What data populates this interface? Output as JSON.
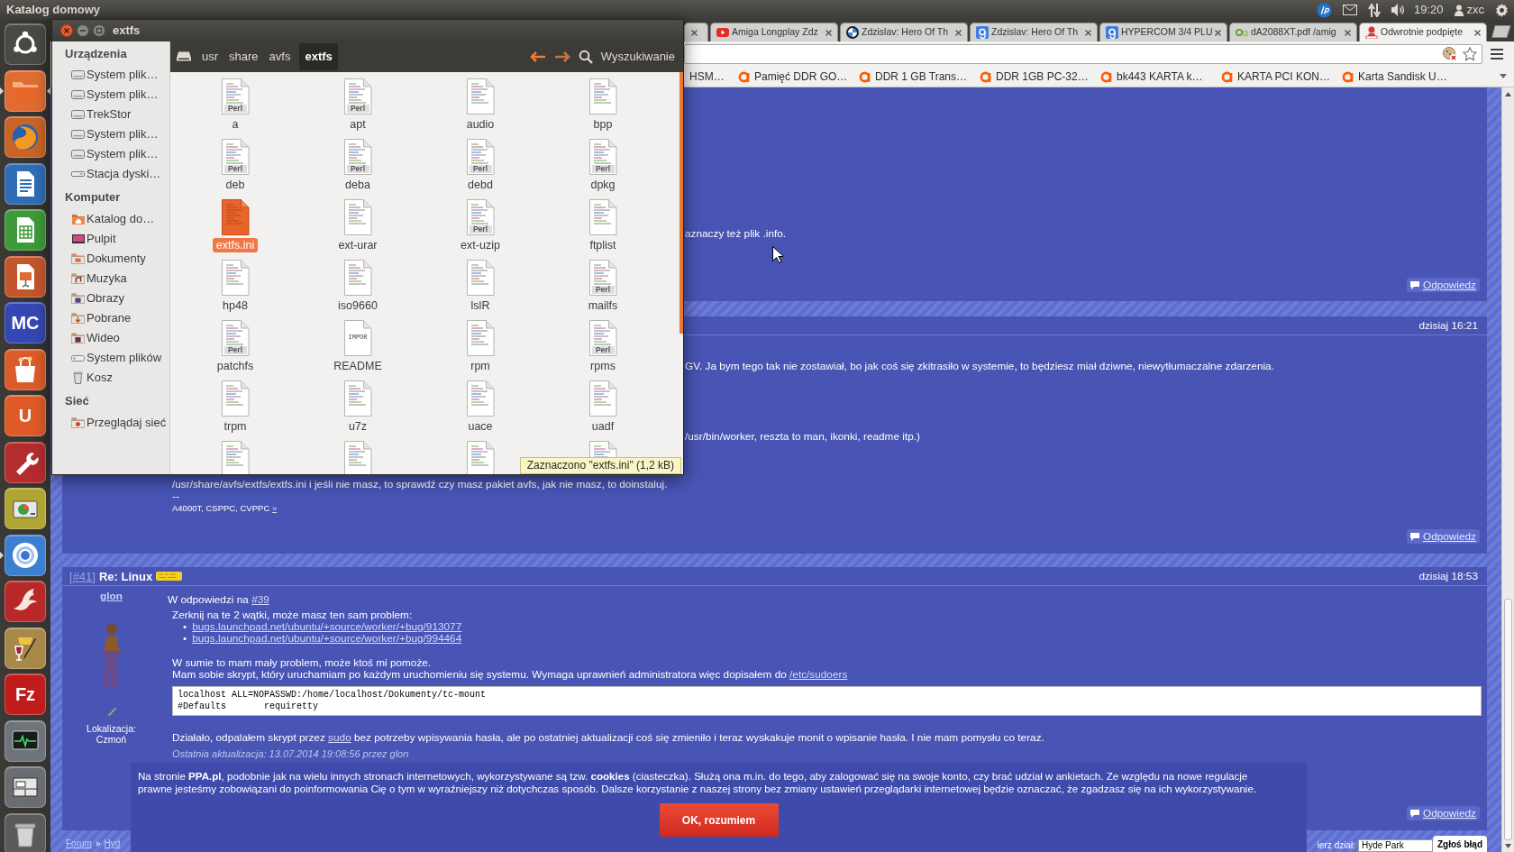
{
  "top_panel": {
    "title": "Katalog domowy",
    "clock": "19:20",
    "user": "zxc"
  },
  "launcher": [
    {
      "kind": "dash",
      "color": "#4a4946",
      "running": false,
      "focused": false
    },
    {
      "kind": "folder",
      "color": "#e06c34",
      "running": true,
      "focused": true
    },
    {
      "kind": "globe",
      "color": "#c86428",
      "running": false,
      "focused": false
    },
    {
      "kind": "document",
      "color": "#2f6db5",
      "running": false,
      "focused": false
    },
    {
      "kind": "spreadsheet",
      "color": "#3e9a3a",
      "running": false,
      "focused": false
    },
    {
      "kind": "slides",
      "color": "#c4562c",
      "running": false,
      "focused": false
    },
    {
      "kind": "letters",
      "text": "MC",
      "color": "#3547b3",
      "running": false,
      "focused": false
    },
    {
      "kind": "bag",
      "color": "#dc5b2a",
      "running": false,
      "focused": false
    },
    {
      "kind": "letters",
      "text": "U",
      "color": "#e05a28",
      "running": false,
      "focused": false
    },
    {
      "kind": "tools",
      "color": "#b32d2d",
      "running": false,
      "focused": false
    },
    {
      "kind": "disk",
      "color": "#b0a432",
      "running": false,
      "focused": false
    },
    {
      "kind": "ring",
      "color": "#3b7fd0",
      "running": true,
      "focused": false
    },
    {
      "kind": "bird",
      "color": "#b82828",
      "running": false,
      "focused": false
    },
    {
      "kind": "paint",
      "color": "#a8884a",
      "running": false,
      "focused": false
    },
    {
      "kind": "letters",
      "text": "Fz",
      "color": "#c01c1c",
      "running": false,
      "focused": false
    },
    {
      "kind": "monitor",
      "color": "#6e747a",
      "running": false,
      "focused": false
    },
    {
      "kind": "window",
      "color": "#6a6e72",
      "running": false,
      "focused": false
    },
    {
      "kind": "trash",
      "color": "#5a5a5a",
      "running": false,
      "focused": false
    }
  ],
  "file_manager": {
    "title": "extfs",
    "sidebar": [
      {
        "heading": "Urządzenia",
        "items": [
          {
            "kind": "drive",
            "label": "System plik…"
          },
          {
            "kind": "drive",
            "label": "System plik…"
          },
          {
            "kind": "drive",
            "label": "TrekStor"
          },
          {
            "kind": "drive",
            "label": "System plik…"
          },
          {
            "kind": "drive",
            "label": "System plik…"
          },
          {
            "kind": "removable",
            "label": "Stacja dyski…"
          }
        ]
      },
      {
        "heading": "Komputer",
        "items": [
          {
            "kind": "home",
            "label": "Katalog do…"
          },
          {
            "kind": "desktop",
            "label": "Pulpit"
          },
          {
            "kind": "documents",
            "label": "Dokumenty"
          },
          {
            "kind": "music",
            "label": "Muzyka"
          },
          {
            "kind": "pictures",
            "label": "Obrazy"
          },
          {
            "kind": "downloads",
            "label": "Pobrane"
          },
          {
            "kind": "videos",
            "label": "Wideo"
          },
          {
            "kind": "filesystem",
            "label": "System plików"
          },
          {
            "kind": "trash",
            "label": "Kosz"
          }
        ]
      },
      {
        "heading": "Sieć",
        "items": [
          {
            "kind": "network",
            "label": "Przeglądaj sieć"
          }
        ]
      }
    ],
    "path": [
      {
        "label": "usr",
        "selected": false
      },
      {
        "label": "share",
        "selected": false
      },
      {
        "label": "avfs",
        "selected": false
      },
      {
        "label": "extfs",
        "selected": true
      }
    ],
    "search": "Wyszukiwanie",
    "files": [
      {
        "name": "a",
        "kind": "perl",
        "badge": "Perl",
        "selected": false
      },
      {
        "name": "apt",
        "kind": "perl",
        "badge": "Perl",
        "selected": false
      },
      {
        "name": "audio",
        "kind": "text",
        "selected": false
      },
      {
        "name": "bpp",
        "kind": "text",
        "selected": false
      },
      {
        "name": "deb",
        "kind": "perl",
        "badge": "Perl",
        "selected": false
      },
      {
        "name": "deba",
        "kind": "perl",
        "badge": "Perl",
        "selected": false
      },
      {
        "name": "debd",
        "kind": "perl",
        "badge": "Perl",
        "selected": false
      },
      {
        "name": "dpkg",
        "kind": "perl",
        "badge": "Perl",
        "selected": false
      },
      {
        "name": "extfs.ini",
        "kind": "text",
        "selected": true
      },
      {
        "name": "ext-urar",
        "kind": "text",
        "selected": false
      },
      {
        "name": "ext-uzip",
        "kind": "perl",
        "badge": "Perl",
        "selected": false
      },
      {
        "name": "ftplist",
        "kind": "text",
        "selected": false
      },
      {
        "name": "hp48",
        "kind": "text",
        "selected": false
      },
      {
        "name": "iso9660",
        "kind": "text",
        "selected": false
      },
      {
        "name": "lslR",
        "kind": "text",
        "selected": false
      },
      {
        "name": "mailfs",
        "kind": "perl",
        "badge": "Perl",
        "selected": false
      },
      {
        "name": "patchfs",
        "kind": "perl",
        "badge": "Perl",
        "selected": false
      },
      {
        "name": "README",
        "kind": "readme",
        "badge": "IMPOR",
        "selected": false
      },
      {
        "name": "rpm",
        "kind": "text",
        "selected": false
      },
      {
        "name": "rpms",
        "kind": "perl",
        "badge": "Perl",
        "selected": false
      },
      {
        "name": "trpm",
        "kind": "text",
        "selected": false
      },
      {
        "name": "u7z",
        "kind": "text",
        "selected": false
      },
      {
        "name": "uace",
        "kind": "text",
        "selected": false
      },
      {
        "name": "uadf",
        "kind": "text",
        "selected": false
      },
      {
        "kind": "text",
        "selected": false
      },
      {
        "kind": "text",
        "selected": false
      },
      {
        "kind": "text",
        "selected": false
      },
      {
        "kind": "text",
        "selected": false
      }
    ],
    "status": "Zaznaczono \"extfs.ini\" (1,2 kB)"
  },
  "browser": {
    "tabs": [
      {
        "kind": "blank",
        "selected": false
      },
      {
        "kind": "video",
        "title": "Amiga Longplay Zdz",
        "selected": false
      },
      {
        "kind": "disc",
        "title": "Zdzislav: Hero Of Th",
        "selected": false
      },
      {
        "kind": "square",
        "title": "Zdzislav: Hero Of Th",
        "selected": false
      },
      {
        "kind": "square",
        "title": "HYPERCOM 3/4 PLU",
        "selected": false
      },
      {
        "kind": "leaf",
        "title": "dA2088XT.pdf /amig",
        "selected": false
      },
      {
        "kind": "ppa",
        "title": "Odwrotnie podpięte",
        "selected": true
      }
    ],
    "bookmarks": [
      {
        "label": "HSM…",
        "icon": false
      },
      {
        "label": "Pamięć DDR GO…",
        "icon": true
      },
      {
        "label": "DDR 1 GB Trans…",
        "icon": true
      },
      {
        "label": "DDR 1GB PC-32…",
        "icon": true
      },
      {
        "label": "bk443 KARTA k…",
        "icon": true
      },
      {
        "label": "KARTA PCI KON…",
        "icon": true
      },
      {
        "label": "Karta Sandisk U…",
        "icon": true
      }
    ]
  },
  "forum": {
    "posts": [
      {
        "kind": "continued",
        "body": [
          {
            "kind": "cut",
            "parts": [
              {
                "text": "aznaczy też plik .info."
              }
            ]
          }
        ],
        "reply": "Odpowiedz"
      },
      {
        "kind": "partial",
        "date": "dzisiaj 16:21",
        "body": [
          {
            "kind": "cut",
            "parts": [
              {
                "text": "GV. Ja bym tego tak nie zostawiał, bo jak coś się zkitrasiło w systemie, to będziesz miał dziwne, niewytłumaczalne zdarzenia."
              }
            ]
          },
          {
            "kind": "cut",
            "parts": [
              {
                "text": "/usr/bin/worker, reszta to man, ikonki, readme itp.)"
              }
            ]
          },
          {
            "kind": "text",
            "parts": [
              {
                "text": "/usr/share/avfs/extfs/extfs.ini i jeśli nie masz, to sprawdź czy masz pakiet avfs, jak nie masz, to doinstaluj."
              }
            ]
          },
          {
            "kind": "text",
            "parts": [
              {
                "text": "--"
              }
            ]
          },
          {
            "kind": "signature",
            "parts": [
              {
                "text": "A4000T, CSPPC, CVPPC "
              },
              {
                "link": "»"
              }
            ]
          }
        ],
        "reply": "Odpowiedz"
      },
      {
        "kind": "full",
        "ref": [
          {
            "text": "["
          },
          {
            "link": "#41"
          },
          {
            "text": "]"
          }
        ],
        "title": "Re: Linux",
        "date": "dzisiaj 18:53",
        "author": "glon",
        "location_label": "Lokalizacja:",
        "location": "Czmoń",
        "reply_to": [
          {
            "text": "W odpowiedzi na "
          },
          {
            "link": "#39"
          }
        ],
        "body": [
          {
            "kind": "text",
            "parts": [
              {
                "text": "Zerknij na te 2 wątki, może masz ten sam problem:"
              }
            ]
          },
          {
            "kind": "links",
            "marker": "•",
            "items": [
              "bugs.launchpad.net/ubuntu/+source/worker/+bug/913077",
              "bugs.launchpad.net/ubuntu/+source/worker/+bug/994464"
            ]
          },
          {
            "kind": "text",
            "parts": [
              {
                "text": "W sumie to mam mały problem, może ktoś mi pomoże."
              }
            ]
          },
          {
            "kind": "text",
            "parts": [
              {
                "text": "Mam sobie skrypt, który uruchamiam po każdym uruchomieniu się systemu. Wymaga uprawnień administratora więc dopisałem do "
              },
              {
                "link": "/etc/sudoers"
              }
            ]
          },
          {
            "kind": "code",
            "lines": [
              "localhost ALL=NOPASSWD:/home/localhost/Dokumenty/tc-mount",
              "#Defaults\trequiretty"
            ]
          },
          {
            "kind": "text",
            "parts": [
              {
                "text": "Działało, odpalałem skrypt przez "
              },
              {
                "link": "sudo"
              },
              {
                "text": " bez potrzeby wpisywania hasła, ale po ostatniej aktualizacji coś się zmieniło i teraz wyskakuje monit o wpisanie hasła. I nie mam pomysłu co teraz."
              }
            ]
          },
          {
            "kind": "edited",
            "parts": [
              {
                "text": "Ostatnia aktualizacja: 13.07.2014 19:08:56 przez glon"
              }
            ]
          }
        ],
        "reply": "Odpowiedz"
      }
    ],
    "breadcrumb": {
      "items": [
        "Forum",
        "Hyd"
      ],
      "separator": "»"
    },
    "section_picker": {
      "label": "ierz dział:",
      "value": "Hyde Park"
    },
    "report_button": "Zgłoś błąd",
    "cookie_notice": {
      "text": "Na stronie **PPA.pl**, podobnie jak na wielu innych stronach internetowych, wykorzystywane są tzw. **cookies** (ciasteczka). Służą ona m.in. do tego, aby zalogować się na swoje konto, czy brać udział w ankietach. Ze względu na nowe regulacje prawne jesteśmy zobowiązani do poinformowania Cię o tym w wyraźniejszy niż dotychczas sposób. Dalsze korzystanie z naszej strony bez zmiany ustawień przeglądarki internetowej będzie oznaczać, że zgadzasz się na ich wykorzystywanie.",
      "button": "OK, rozumiem"
    }
  }
}
